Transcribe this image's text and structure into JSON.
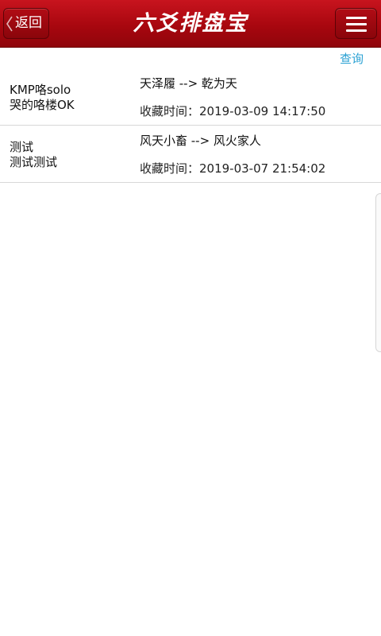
{
  "header": {
    "back_label": "返回",
    "title": "六爻排盘宝",
    "menu_icon": "hamburger-menu-icon",
    "back_icon": "chevron-left-icon",
    "bar_color": "#a8070f"
  },
  "toolbar": {
    "query_label": "查询",
    "link_color": "#2aa1d3"
  },
  "records": [
    {
      "name_line1": "KMP咯solo",
      "name_line2": "哭的咯楼OK",
      "gua": "天泽履 --> 乾为天",
      "time": "收藏时间：2019-03-09 14:17:50"
    },
    {
      "name_line1": "测试",
      "name_line2": "测试测试",
      "gua": "风天小畜 --> 风火家人",
      "time": "收藏时间：2019-03-07 21:54:02"
    }
  ]
}
